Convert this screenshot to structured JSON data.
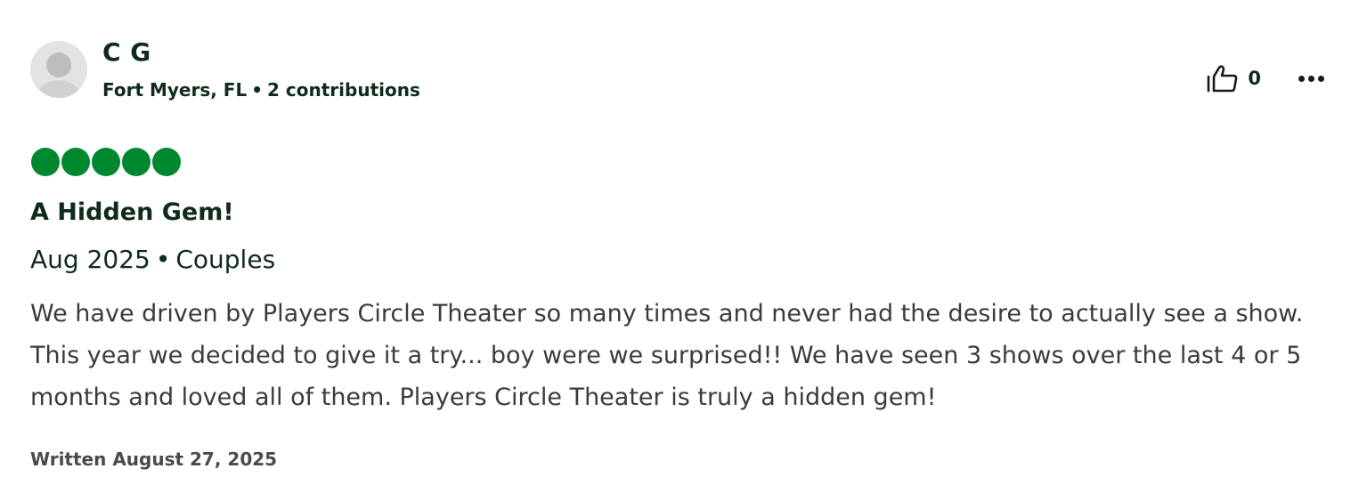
{
  "review": {
    "user": {
      "name": "C G",
      "location": "Fort Myers, FL",
      "separator": "•",
      "contributions": "2 contributions",
      "avatar_icon": "default-user-avatar-icon"
    },
    "actions": {
      "like_icon": "thumbs-up-icon",
      "like_count": "0",
      "more_icon": "more-options-icon"
    },
    "rating": {
      "value": 5,
      "max": 5,
      "color": "#00882f"
    },
    "title": "A Hidden Gem!",
    "visit_date": "Aug 2025",
    "trip_separator": "•",
    "trip_type": "Couples",
    "text": "We have driven by Players Circle Theater so many times and never had the desire to actually see a show. This year we decided to give it a try... boy were we surprised!! We have seen 3 shows over the last 4 or 5 months and loved all of them. Players Circle Theater is truly a hidden gem!",
    "written": "Written August 27, 2025"
  }
}
